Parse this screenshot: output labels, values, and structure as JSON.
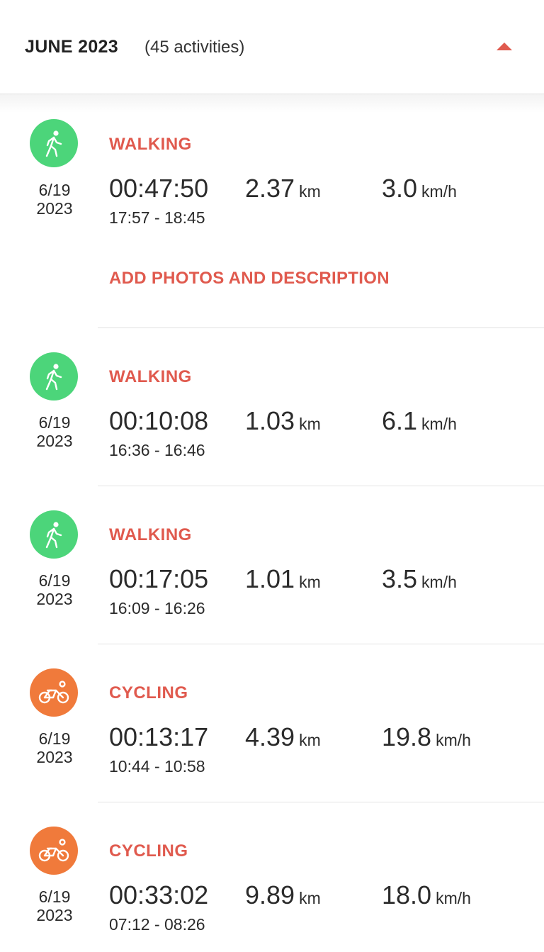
{
  "header": {
    "month": "JUNE 2023",
    "count": "(45 activities)",
    "collapse_icon": "caret-up-icon"
  },
  "colors": {
    "accent": "#e05a4e",
    "walking": "#4cd57a",
    "cycling": "#f07a3b"
  },
  "activities": [
    {
      "type": "WALKING",
      "icon": "walking-icon",
      "date_md": "6/19",
      "date_y": "2023",
      "duration": "00:47:50",
      "distance": "2.37",
      "distance_unit": "km",
      "speed": "3.0",
      "speed_unit": "km/h",
      "time_range": "17:57 - 18:45",
      "action": "ADD PHOTOS AND DESCRIPTION"
    },
    {
      "type": "WALKING",
      "icon": "walking-icon",
      "date_md": "6/19",
      "date_y": "2023",
      "duration": "00:10:08",
      "distance": "1.03",
      "distance_unit": "km",
      "speed": "6.1",
      "speed_unit": "km/h",
      "time_range": "16:36 - 16:46"
    },
    {
      "type": "WALKING",
      "icon": "walking-icon",
      "date_md": "6/19",
      "date_y": "2023",
      "duration": "00:17:05",
      "distance": "1.01",
      "distance_unit": "km",
      "speed": "3.5",
      "speed_unit": "km/h",
      "time_range": "16:09 - 16:26"
    },
    {
      "type": "CYCLING",
      "icon": "cycling-icon",
      "date_md": "6/19",
      "date_y": "2023",
      "duration": "00:13:17",
      "distance": "4.39",
      "distance_unit": "km",
      "speed": "19.8",
      "speed_unit": "km/h",
      "time_range": "10:44 - 10:58"
    },
    {
      "type": "CYCLING",
      "icon": "cycling-icon",
      "date_md": "6/19",
      "date_y": "2023",
      "duration": "00:33:02",
      "distance": "9.89",
      "distance_unit": "km",
      "speed": "18.0",
      "speed_unit": "km/h",
      "time_range": "07:12 - 08:26"
    }
  ]
}
